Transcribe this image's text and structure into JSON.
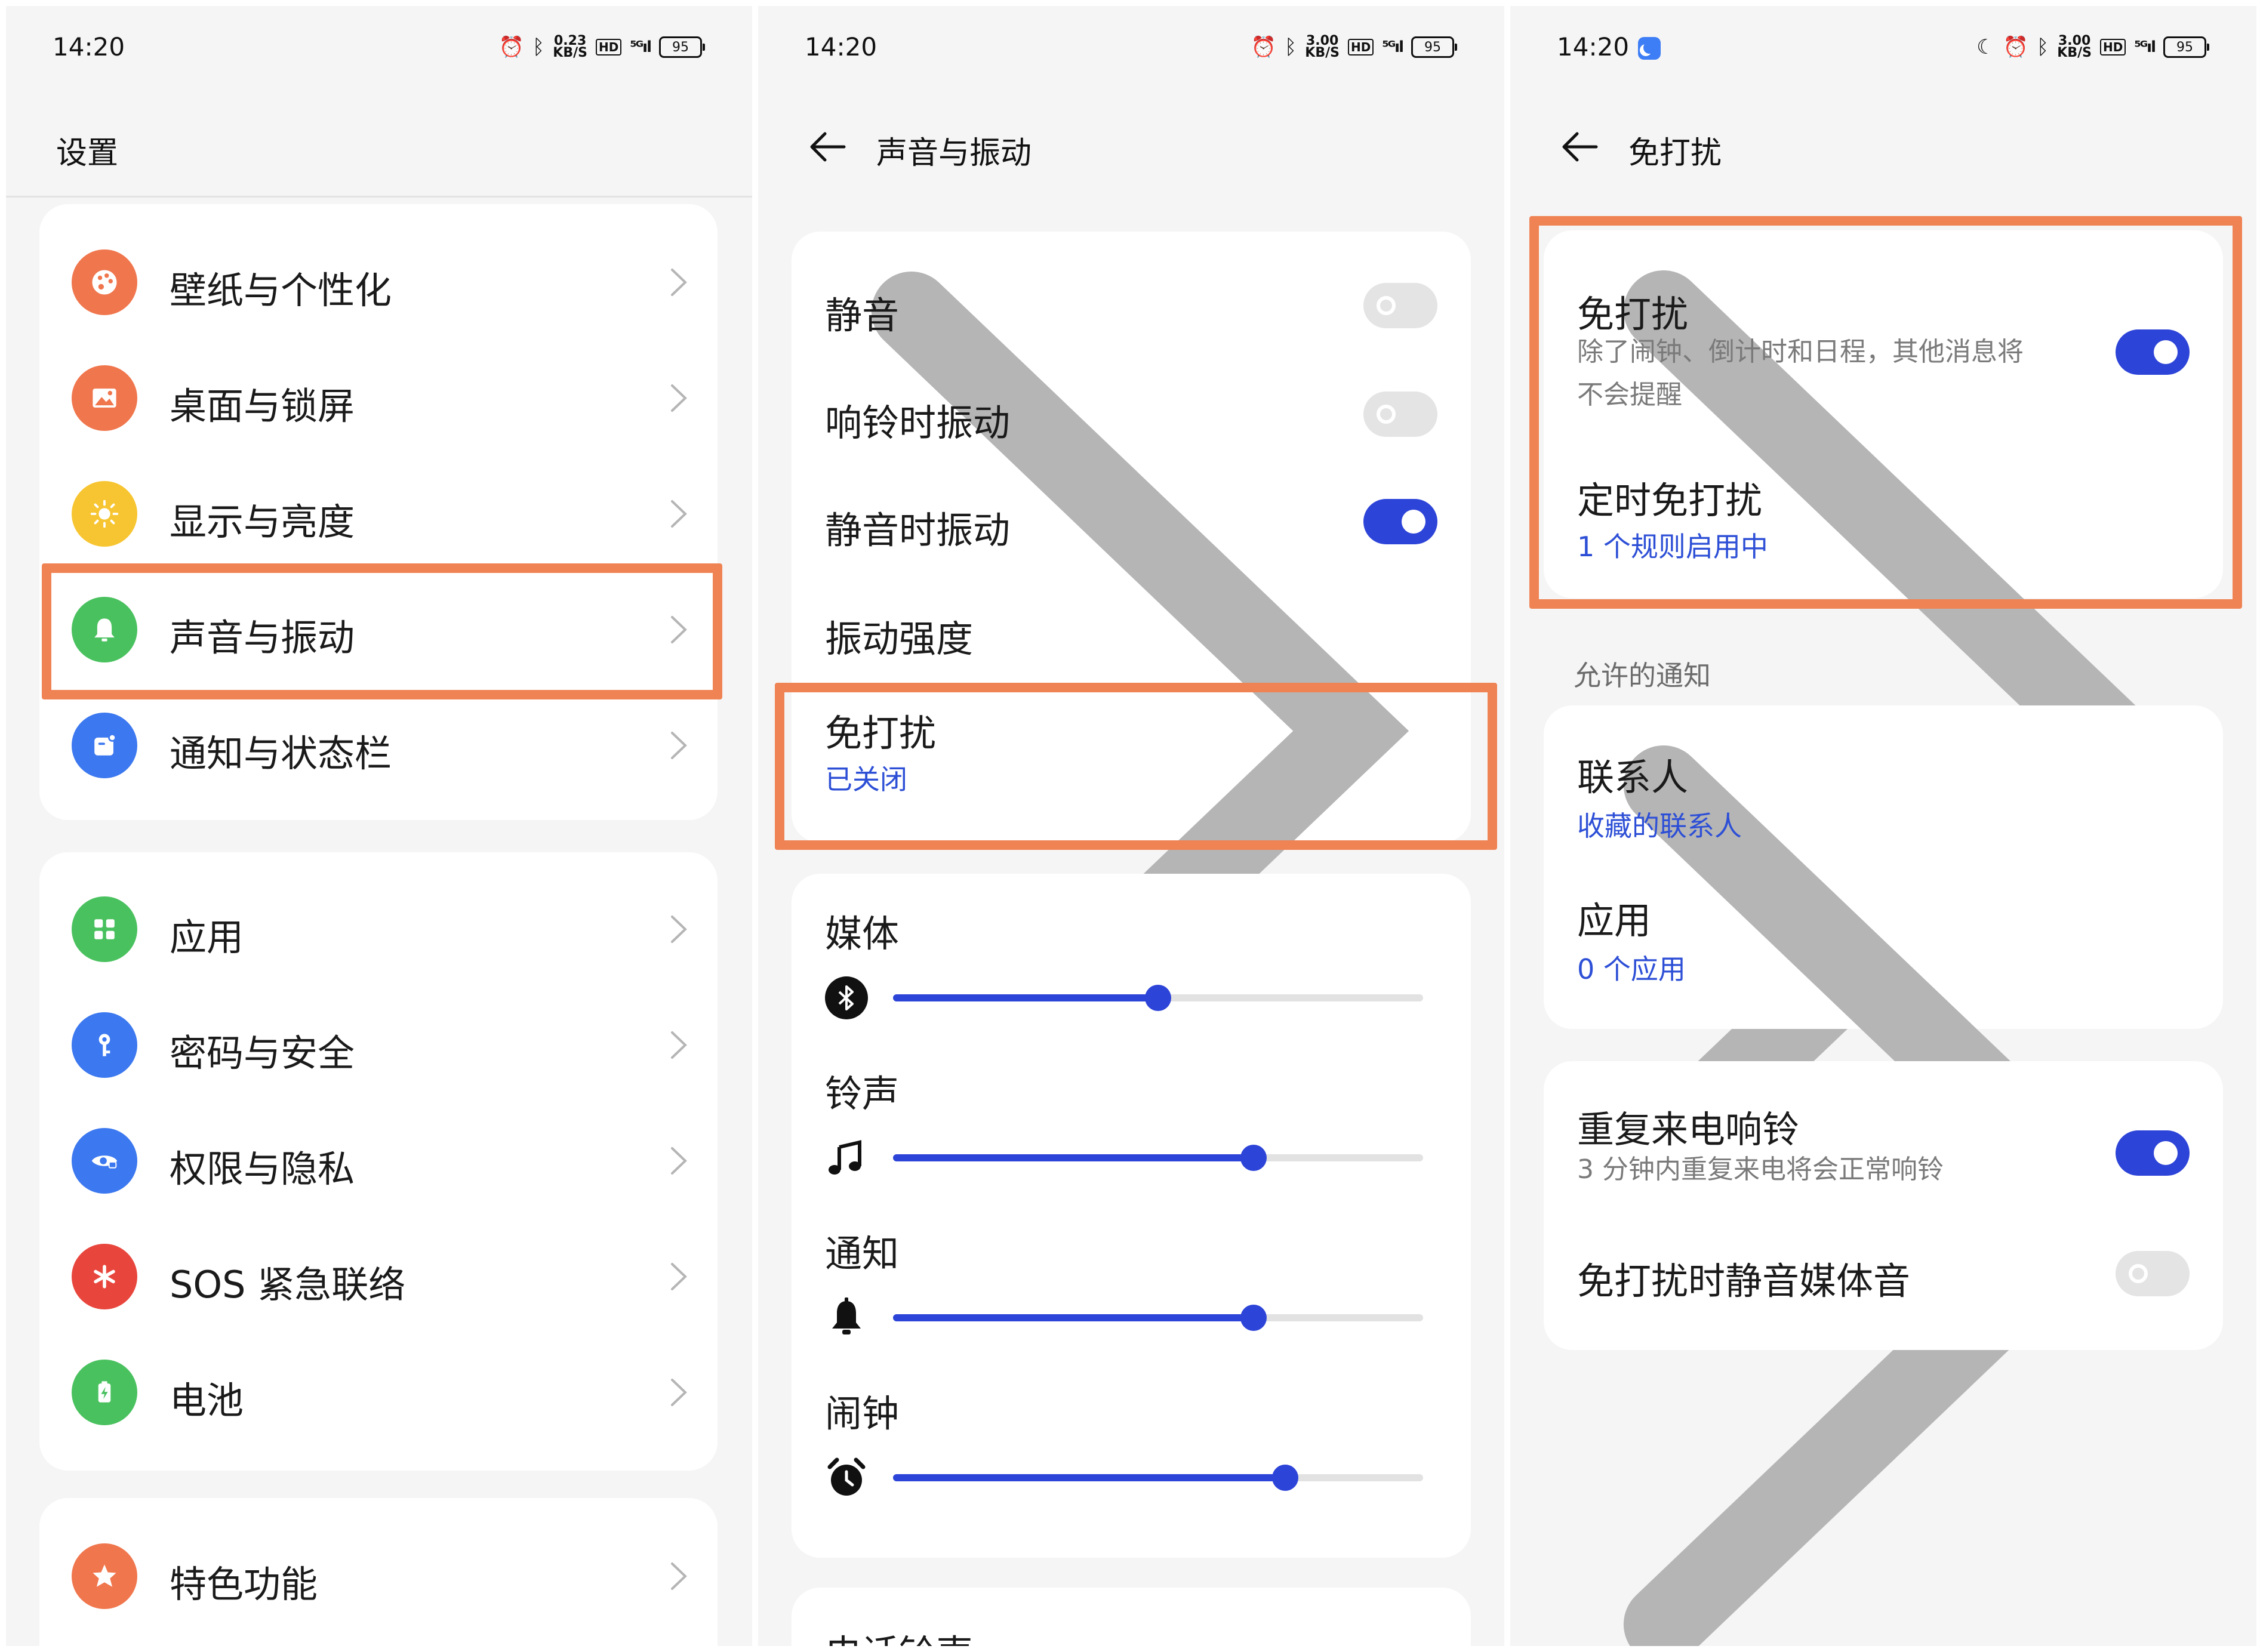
{
  "colors": {
    "accent": "#2d44d8",
    "highlight": "#ef8354",
    "link_text": "#2d4fd6"
  },
  "status_bar": {
    "time": "14:20",
    "panel1_speed": "0.23\nKB/S",
    "panel2_speed": "3.00\nKB/S",
    "panel3_speed": "3.00\nKB/S",
    "hd": "HD",
    "signal": "⁵ᴳıl",
    "battery": "95"
  },
  "settings": {
    "title": "设置",
    "group1": [
      {
        "label": "壁纸与个性化",
        "icon": "palette-icon",
        "color": "#f0764d"
      },
      {
        "label": "桌面与锁屏",
        "icon": "picture-icon",
        "color": "#f0764d"
      },
      {
        "label": "显示与亮度",
        "icon": "sun-icon",
        "color": "#f7c531"
      },
      {
        "label": "声音与振动",
        "icon": "bell-icon",
        "color": "#4ac15f"
      },
      {
        "label": "通知与状态栏",
        "icon": "notification-icon",
        "color": "#3c78ef"
      }
    ],
    "group2": [
      {
        "label": "应用",
        "icon": "apps-icon",
        "color": "#4ac15f"
      },
      {
        "label": "密码与安全",
        "icon": "key-icon",
        "color": "#3c78ef"
      },
      {
        "label": "权限与隐私",
        "icon": "privacy-eye-icon",
        "color": "#3c78ef"
      },
      {
        "label": "SOS 紧急联络",
        "icon": "sos-asterisk-icon",
        "color": "#e8463d"
      },
      {
        "label": "电池",
        "icon": "battery-icon",
        "color": "#4ac15f"
      }
    ],
    "group3": [
      {
        "label": "特色功能",
        "icon": "star-icon",
        "color": "#f0764d"
      }
    ]
  },
  "sound": {
    "title": "声音与振动",
    "silent": {
      "label": "静音",
      "on": false
    },
    "vibrate_ring": {
      "label": "响铃时振动",
      "on": false
    },
    "vibrate_silent": {
      "label": "静音时振动",
      "on": true
    },
    "vibration_strength": "振动强度",
    "dnd": {
      "label": "免打扰",
      "status": "已关闭"
    },
    "volumes": [
      {
        "label": "媒体",
        "icon": "bluetooth-icon",
        "level": 0.5
      },
      {
        "label": "铃声",
        "icon": "music-note-icon",
        "level": 0.68
      },
      {
        "label": "通知",
        "icon": "bell-icon",
        "level": 0.68
      },
      {
        "label": "闹钟",
        "icon": "alarm-clock-icon",
        "level": 0.74
      }
    ],
    "next_section_partial": "电话铃声"
  },
  "dnd_page": {
    "title": "免打扰",
    "dnd_toggle": {
      "label": "免打扰",
      "desc_line1": "除了闹钟、倒计时和日程，其他消息将",
      "desc_line2": "不会提醒",
      "on": true
    },
    "scheduled": {
      "label": "定时免打扰",
      "sub": "1 个规则启用中"
    },
    "allowed_label": "允许的通知",
    "contacts": {
      "label": "联系人",
      "sub": "收藏的联系人"
    },
    "apps": {
      "label": "应用",
      "sub": "0 个应用"
    },
    "repeat_calls": {
      "label": "重复来电响铃",
      "desc": "3 分钟内重复来电将会正常响铃",
      "on": true
    },
    "mute_media": {
      "label": "免打扰时静音媒体音",
      "on": false
    }
  }
}
